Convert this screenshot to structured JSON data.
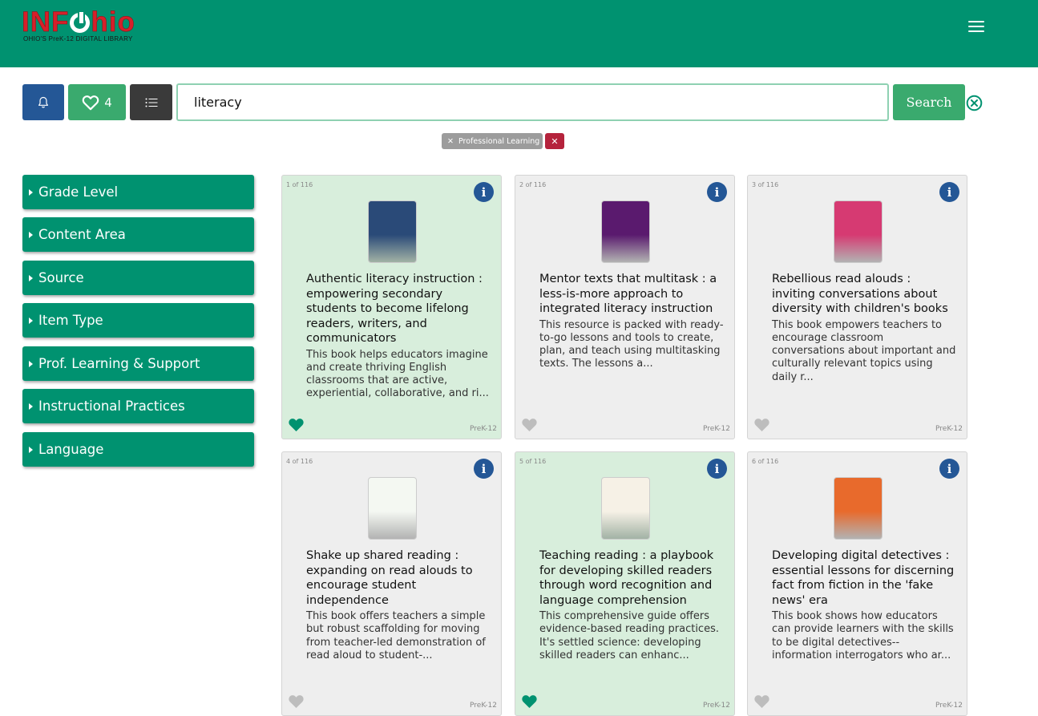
{
  "header": {
    "logo_main_left": "INF",
    "logo_main_right": "hio",
    "logo_sub": "OHIO'S PreK-12 DIGITAL LIBRARY"
  },
  "toolbar": {
    "favorites_count": "4",
    "search_value": "literacy",
    "search_label": "Search"
  },
  "filters": {
    "chips": [
      {
        "label": "Professional Learning"
      }
    ]
  },
  "facets": [
    {
      "label": "Grade Level"
    },
    {
      "label": "Content Area"
    },
    {
      "label": "Source"
    },
    {
      "label": "Item Type"
    },
    {
      "label": "Prof. Learning & Support"
    },
    {
      "label": "Instructional Practices"
    },
    {
      "label": "Language"
    }
  ],
  "results": [
    {
      "index": "1 of 116",
      "favorited": true,
      "title": "Authentic literacy instruction : empowering secondary students to become lifelong readers, writers, and communicators",
      "description": "This book helps educators imagine and create thriving English classrooms that are active, experiential, collaborative, and ri...",
      "grade": "PreK-12",
      "cover_color": "#2a4a78"
    },
    {
      "index": "2 of 116",
      "favorited": false,
      "title": "Mentor texts that multitask : a less-is-more approach to integrated literacy instruction",
      "description": "This resource is packed with ready-to-go lessons and tools to create, plan, and teach using multitasking texts. The lessons a...",
      "grade": "PreK-12",
      "cover_color": "#5a1a6e"
    },
    {
      "index": "3 of 116",
      "favorited": false,
      "title": "Rebellious read alouds : inviting conversations about diversity with children's books",
      "description": "This book empowers teachers to encourage classroom conversations about important and culturally relevant topics using daily r...",
      "grade": "PreK-12",
      "cover_color": "#d63a72"
    },
    {
      "index": "4 of 116",
      "favorited": false,
      "title": "Shake up shared reading : expanding on read alouds to encourage student independence",
      "description": "This book offers teachers a simple but robust scaffolding for moving from teacher-led demonstration of read aloud to student-...",
      "grade": "PreK-12",
      "cover_color": "#f4f8f2"
    },
    {
      "index": "5 of 116",
      "favorited": true,
      "title": "Teaching reading : a playbook for developing skilled readers through word recognition and language comprehension",
      "description": "This comprehensive guide offers evidence-based reading practices. It's settled science: developing skilled readers can enhanc...",
      "grade": "PreK-12",
      "cover_color": "#f6f1e6"
    },
    {
      "index": "6 of 116",
      "favorited": false,
      "title": "Developing digital detectives : essential lessons for discerning fact from fiction in the 'fake news' era",
      "description": "This book shows how educators can provide learners with the skills to be digital detectives--information interrogators who ar...",
      "grade": "PreK-12",
      "cover_color": "#e86a2c"
    }
  ],
  "colors": {
    "brand_green": "#009270",
    "accent_green": "#3aaa6e",
    "info_blue": "#245796",
    "chip_red": "#b5233c",
    "card_grey": "#eeeeee",
    "card_fav": "#d8eedc"
  }
}
